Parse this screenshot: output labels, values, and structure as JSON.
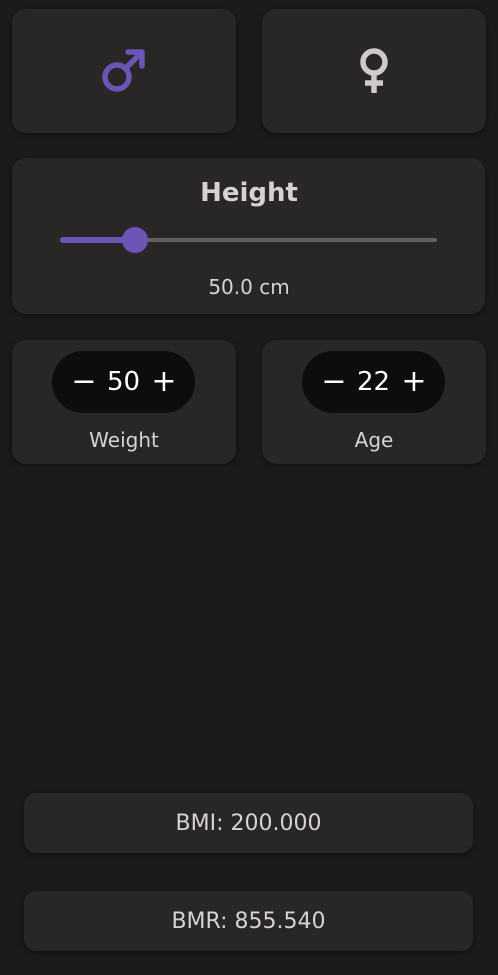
{
  "gender": {
    "male": {
      "icon": "male-symbol-icon",
      "color": "#6c55b6",
      "selected": true
    },
    "female": {
      "icon": "female-symbol-icon",
      "color": "#cfcaca",
      "selected": false
    }
  },
  "height": {
    "title": "Height",
    "value_text": "50.0 cm",
    "slider_fraction": 0.2,
    "accent_color": "#6c55b6"
  },
  "weight": {
    "value": "50",
    "label": "Weight",
    "minus_label": "−",
    "plus_label": "+"
  },
  "age": {
    "value": "22",
    "label": "Age",
    "minus_label": "−",
    "plus_label": "+"
  },
  "results": {
    "bmi": "BMI: 200.000",
    "bmr": "BMR: 855.540"
  }
}
